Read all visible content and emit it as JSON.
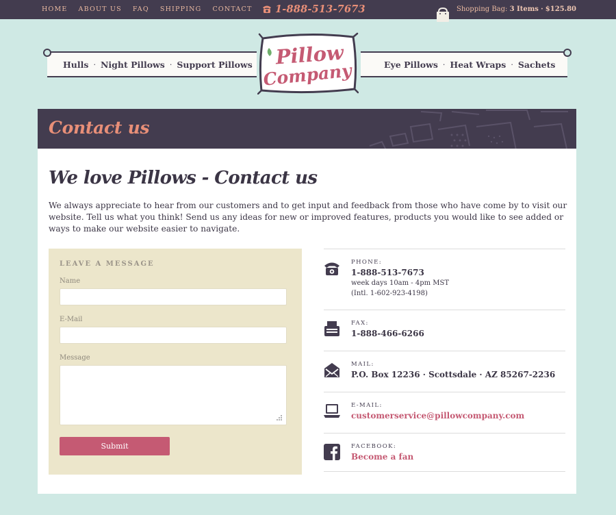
{
  "topbar": {
    "nav": [
      "HOME",
      "ABOUT US",
      "FAQ",
      "SHIPPING",
      "CONTACT"
    ],
    "phone": "1-888-513-7673",
    "bag_label": "Shopping Bag:",
    "bag_items": "3 Items",
    "bag_sep": "·",
    "bag_total": "$125.80"
  },
  "header": {
    "left_links": [
      "Hulls",
      "Night Pillows",
      "Support Pillows"
    ],
    "right_links": [
      "Eye Pillows",
      "Heat Wraps",
      "Sachets"
    ],
    "logo_line1": "Pillow",
    "logo_line2": "Company"
  },
  "colors": {
    "accent": "#c55a73",
    "salmon": "#e88f78",
    "dark": "#433c4f",
    "background": "#cfe9e4",
    "form_panel": "#ece6cb"
  },
  "page": {
    "banner_title": "Contact us",
    "title": "We love Pillows - Contact us",
    "intro": "We always appreciate to hear from our customers and to get input and feedback from those who have come by to visit our website. Tell us what you think! Send us any ideas for new or improved features, products you would like to see added or ways to make our website easier to navigate."
  },
  "form": {
    "legend": "Leave a Message",
    "name_label": "Name",
    "name_value": "",
    "email_label": "E-Mail",
    "email_value": "",
    "message_label": "Message",
    "message_value": "",
    "submit_label": "Submit"
  },
  "contacts": {
    "phone": {
      "icon": "telephone-icon",
      "label": "Phone:",
      "value": "1-888-513-7673",
      "note1": "week days 10am - 4pm MST",
      "note2": "(Intl. 1-602-923-4198)"
    },
    "fax": {
      "icon": "fax-icon",
      "label": "Fax:",
      "value": "1-888-466-6266"
    },
    "mail": {
      "icon": "envelope-icon",
      "label": "Mail:",
      "value": "P.O. Box 12236 · Scottsdale · AZ 85267-2236"
    },
    "email": {
      "icon": "laptop-icon",
      "label": "E-Mail:",
      "value": "customerservice@pillowcompany.com"
    },
    "facebook": {
      "icon": "facebook-icon",
      "label": "Facebook:",
      "value": "Become a fan"
    }
  }
}
